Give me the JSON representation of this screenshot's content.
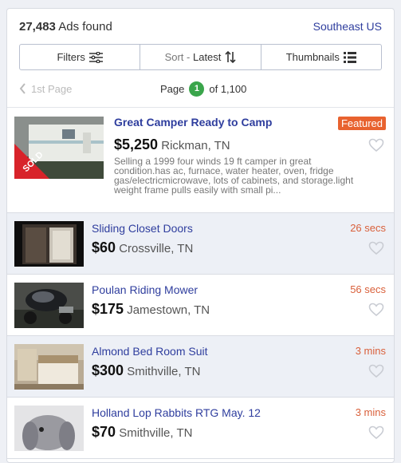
{
  "header": {
    "count": "27,483",
    "count_suffix": " Ads found",
    "region": "Southeast US"
  },
  "controls": {
    "filters_label": "Filters",
    "sort_prefix": "Sort - ",
    "sort_value": "Latest",
    "view_label": "Thumbnails"
  },
  "pager": {
    "prev_label": "1st Page",
    "page_label": "Page",
    "current": "1",
    "total_label": "of 1,100"
  },
  "listings": [
    {
      "title": "Great Camper Ready to Camp",
      "price": "$5,250",
      "location": "Rickman, TN",
      "badge": "Featured",
      "sold_label": "SOLD",
      "description": "Selling a 1999 four winds 19 ft camper in great condition.has ac, furnace, water heater, oven, fridge gas/electricmicrowave, lots of cabinets, and storage.light weight frame pulls easily with small pi..."
    },
    {
      "title": "Sliding Closet Doors",
      "price": "$60",
      "location": "Crossville, TN",
      "age": "26 secs"
    },
    {
      "title": "Poulan Riding Mower",
      "price": "$175",
      "location": "Jamestown, TN",
      "age": "56 secs"
    },
    {
      "title": "Almond Bed Room Suit",
      "price": "$300",
      "location": "Smithville, TN",
      "age": "3 mins"
    },
    {
      "title": "Holland Lop Rabbits RTG May. 12",
      "price": "$70",
      "location": "Smithville, TN",
      "age": "3 mins"
    }
  ],
  "colors": {
    "link": "#2f3e9e",
    "accent": "#e8622f",
    "age": "#d9603b",
    "page_badge": "#3aa54b"
  },
  "icons": [
    "filter-sliders-icon",
    "sort-arrows-icon",
    "list-view-icon",
    "chevron-left-icon",
    "heart-outline-icon"
  ]
}
